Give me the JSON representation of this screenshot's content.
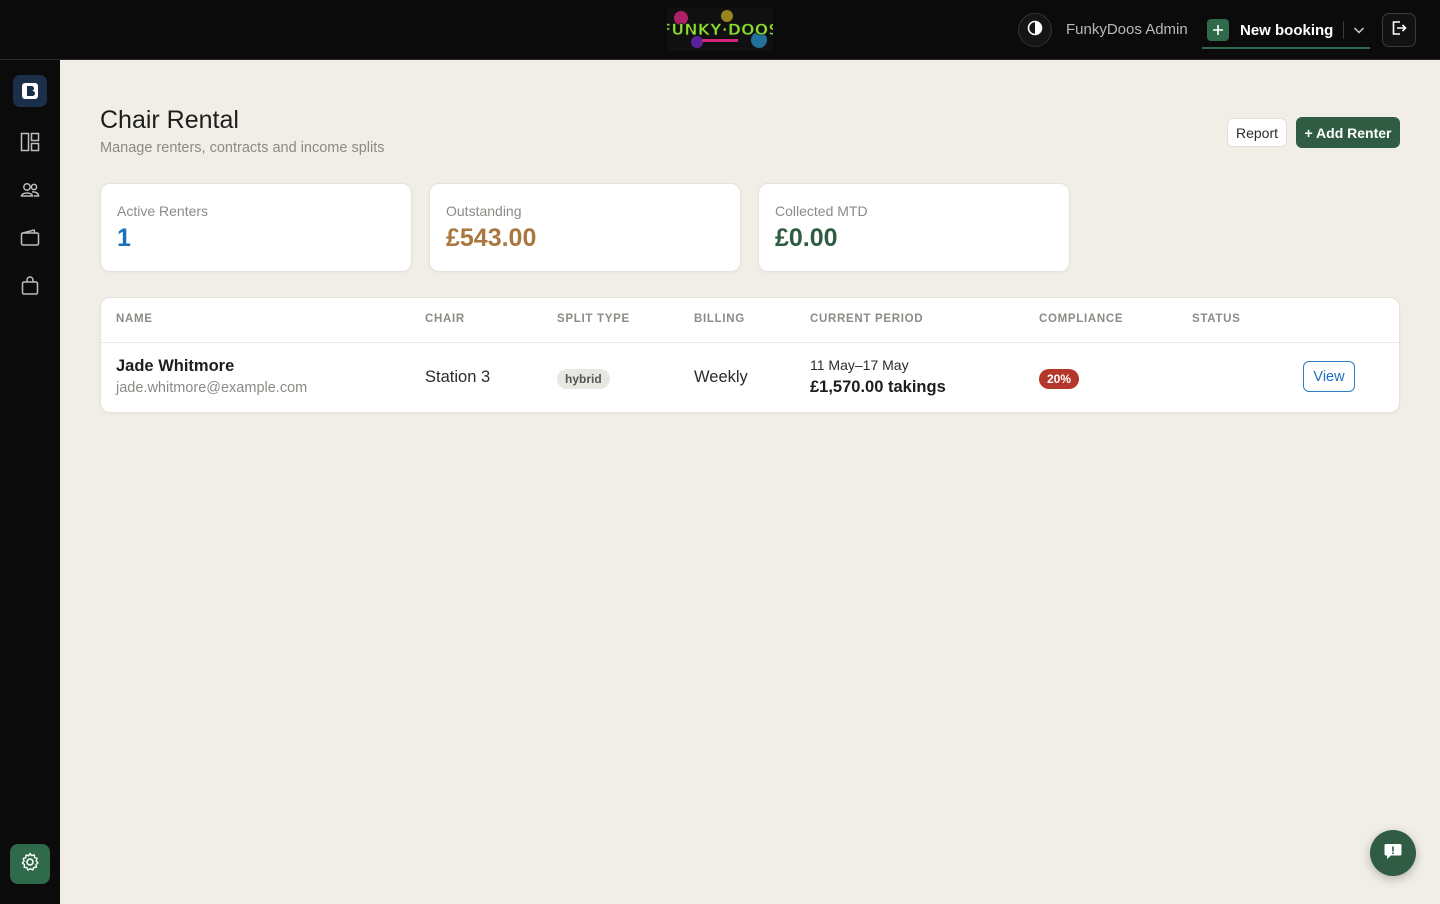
{
  "header": {
    "logo_text": "FUNKY DOOS",
    "admin_name": "FunkyDoos Admin",
    "new_booking_label": "New booking",
    "icons": [
      "contrast-icon",
      "plus-icon",
      "chevron-down-icon",
      "logout-icon"
    ]
  },
  "sidebar": {
    "items": [
      {
        "name": "brand",
        "icon": "brand-b-icon"
      },
      {
        "name": "dashboard",
        "icon": "layout-icon"
      },
      {
        "name": "clients",
        "icon": "users-icon"
      },
      {
        "name": "wallet",
        "icon": "wallet-icon"
      },
      {
        "name": "shop",
        "icon": "bag-icon"
      },
      {
        "name": "settings",
        "icon": "gear-icon"
      }
    ]
  },
  "page": {
    "title": "Chair Rental",
    "subtitle": "Manage renters, contracts and income splits",
    "report_label": "Report",
    "add_renter_label": "+ Add Renter"
  },
  "stats": [
    {
      "label": "Active Renters",
      "value": "1",
      "color": "#1e6fbd"
    },
    {
      "label": "Outstanding",
      "value": "£543.00",
      "color": "#a9773f"
    },
    {
      "label": "Collected MTD",
      "value": "£0.00",
      "color": "#2f5c43"
    }
  ],
  "table": {
    "columns": [
      "NAME",
      "CHAIR",
      "SPLIT TYPE",
      "BILLING",
      "CURRENT PERIOD",
      "COMPLIANCE",
      "STATUS"
    ],
    "rows": [
      {
        "name": "Jade Whitmore",
        "email": "jade.whitmore@example.com",
        "chair": "Station 3",
        "split_type": "hybrid",
        "billing": "Weekly",
        "period_range": "11 May–17 May",
        "period_takings": "£1,570.00 takings",
        "compliance": "20%",
        "status": "",
        "action_label": "View"
      }
    ]
  },
  "colors": {
    "accent_green": "#2f5c43",
    "danger": "#b5372b",
    "link_blue": "#1e6fbd"
  }
}
